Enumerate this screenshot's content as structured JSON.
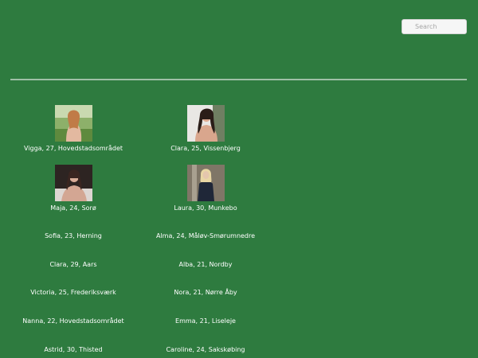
{
  "search": {
    "placeholder": "Search"
  },
  "profiles": [
    {
      "caption": "Vigga, 27, Hovedstadsområdet",
      "photo": "photo-portrait-1"
    },
    {
      "caption": "Clara, 25, Vissenbjerg",
      "photo": "photo-portrait-2"
    },
    {
      "caption": "Maja, 24, Sorø",
      "photo": "photo-portrait-3"
    },
    {
      "caption": "Laura, 30, Munkebo",
      "photo": "photo-portrait-4"
    },
    {
      "caption": "Sofia, 23, Herning"
    },
    {
      "caption": "Alma, 24, Måløv-Smørumnedre"
    },
    {
      "caption": "Clara, 29, Aars"
    },
    {
      "caption": "Alba, 21, Nordby"
    },
    {
      "caption": "Victoria, 25, Frederiksværk"
    },
    {
      "caption": "Nora, 21, Nørre Åby"
    },
    {
      "caption": "Nanna, 22, Hovedstadsområdet"
    },
    {
      "caption": "Emma, 21, Liseleje"
    },
    {
      "caption": "Astrid, 30, Thisted"
    },
    {
      "caption": "Caroline, 24, Sakskøbing"
    }
  ],
  "colors": {
    "page_background": "#2e7b3f",
    "divider": "#9fbfa6",
    "text": "#ffffff"
  }
}
